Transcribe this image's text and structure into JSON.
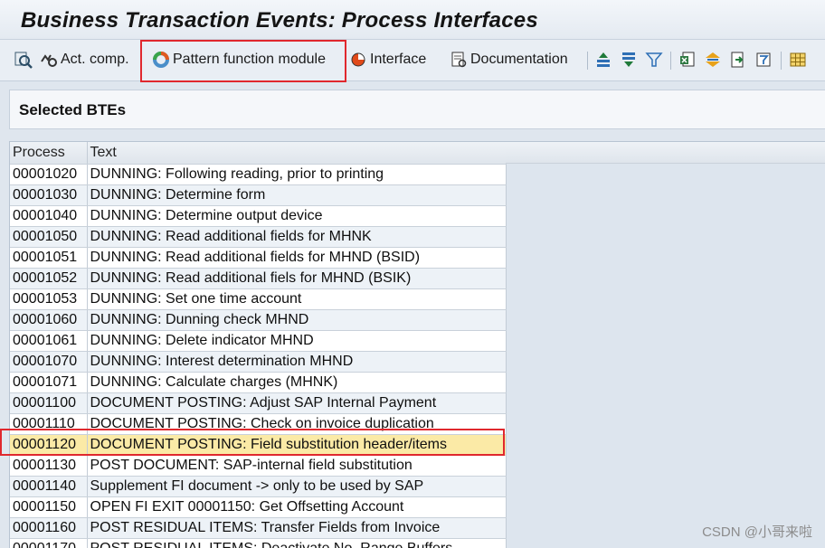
{
  "window": {
    "title": "Business Transaction Events: Process Interfaces"
  },
  "toolbar": {
    "act_comp_label": "Act. comp.",
    "pattern_fm_label": "Pattern function module",
    "interface_label": "Interface",
    "documentation_label": "Documentation",
    "icons": [
      "check-icon",
      "activate-icon",
      "pattern-icon",
      "interface-icon",
      "documentation-icon",
      "sort-ascending-icon",
      "sort-descending-icon",
      "filter-icon",
      "export-excel-icon",
      "expand-icon",
      "export-icon",
      "print-icon",
      "layout-grid-icon"
    ]
  },
  "section": {
    "title": "Selected BTEs"
  },
  "grid": {
    "columns": {
      "process": "Process",
      "text": "Text"
    },
    "rows": [
      {
        "process": "00001020",
        "text": "DUNNING: Following reading, prior to printing"
      },
      {
        "process": "00001030",
        "text": "DUNNING: Determine form"
      },
      {
        "process": "00001040",
        "text": "DUNNING: Determine output device"
      },
      {
        "process": "00001050",
        "text": "DUNNING: Read additional fields for MHNK"
      },
      {
        "process": "00001051",
        "text": "DUNNING: Read additional fields for MHND (BSID)"
      },
      {
        "process": "00001052",
        "text": "DUNNING: Read additional fiels for MHND (BSIK)"
      },
      {
        "process": "00001053",
        "text": "DUNNING: Set one time account"
      },
      {
        "process": "00001060",
        "text": "DUNNING: Dunning check MHND"
      },
      {
        "process": "00001061",
        "text": "DUNNING: Delete indicator MHND"
      },
      {
        "process": "00001070",
        "text": "DUNNING: Interest determination MHND"
      },
      {
        "process": "00001071",
        "text": "DUNNING: Calculate charges (MHNK)"
      },
      {
        "process": "00001100",
        "text": "DOCUMENT POSTING: Adjust SAP Internal Payment"
      },
      {
        "process": "00001110",
        "text": "DOCUMENT POSTING:  Check on invoice duplication"
      },
      {
        "process": "00001120",
        "text": "DOCUMENT POSTING:  Field substitution header/items"
      },
      {
        "process": "00001130",
        "text": "POST DOCUMENT: SAP-internal field substitution"
      },
      {
        "process": "00001140",
        "text": "Supplement FI document -> only to be used by SAP"
      },
      {
        "process": "00001150",
        "text": "OPEN FI EXIT 00001150: Get Offsetting Account"
      },
      {
        "process": "00001160",
        "text": "POST RESIDUAL ITEMS: Transfer Fields from Invoice"
      },
      {
        "process": "00001170",
        "text": "POST RESIDUAL ITEMS: Deactivate No. Range Buffers"
      }
    ]
  },
  "watermark": "CSDN @小哥来啦",
  "colors": {
    "highlight_red": "#e0282e",
    "selected_row": "#fbeaa6",
    "background": "#dfe6ee"
  }
}
